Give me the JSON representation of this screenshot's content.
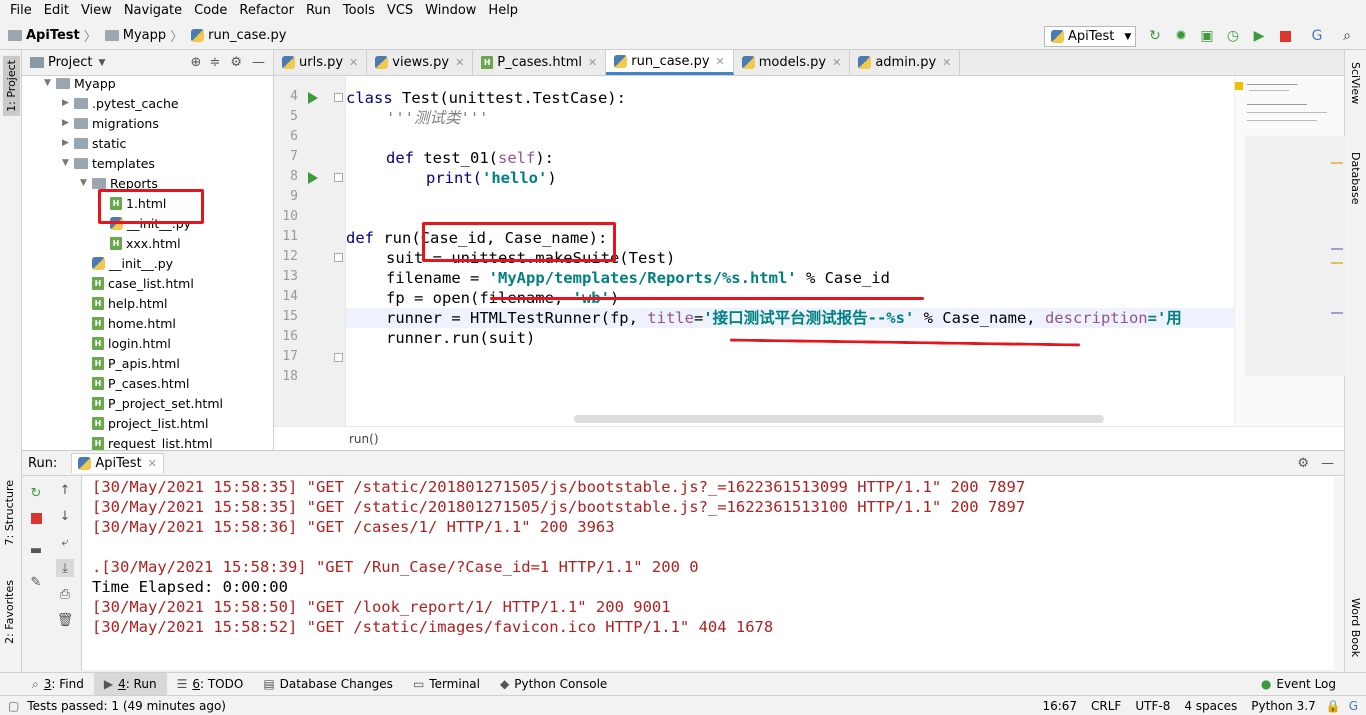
{
  "menu": [
    "File",
    "Edit",
    "View",
    "Navigate",
    "Code",
    "Refactor",
    "Run",
    "Tools",
    "VCS",
    "Window",
    "Help"
  ],
  "nav": {
    "project": "ApiTest",
    "folder": "Myapp",
    "file": "run_case.py"
  },
  "run_config": "ApiTest",
  "side_tabs": {
    "project": "1: Project",
    "structure": "7: Structure",
    "favorites": "2: Favorites",
    "sciview": "SciView",
    "database": "Database",
    "wordbook": "Word Book"
  },
  "project_panel": {
    "title": "Project",
    "items": [
      {
        "label": "Myapp",
        "indent": 0,
        "type": "folder",
        "arrow": "▼"
      },
      {
        "label": ".pytest_cache",
        "indent": 1,
        "type": "folder",
        "arrow": "▶"
      },
      {
        "label": "migrations",
        "indent": 1,
        "type": "folder",
        "arrow": "▶"
      },
      {
        "label": "static",
        "indent": 1,
        "type": "folder",
        "arrow": "▶"
      },
      {
        "label": "templates",
        "indent": 1,
        "type": "folder",
        "arrow": "▼"
      },
      {
        "label": "Reports",
        "indent": 2,
        "type": "folder",
        "arrow": "▼"
      },
      {
        "label": "1.html",
        "indent": 3,
        "type": "html",
        "arrow": ""
      },
      {
        "label": "__init__.py",
        "indent": 3,
        "type": "py",
        "arrow": ""
      },
      {
        "label": "xxx.html",
        "indent": 3,
        "type": "html",
        "arrow": ""
      },
      {
        "label": "__init__.py",
        "indent": 2,
        "type": "py",
        "arrow": ""
      },
      {
        "label": "case_list.html",
        "indent": 2,
        "type": "html",
        "arrow": ""
      },
      {
        "label": "help.html",
        "indent": 2,
        "type": "html",
        "arrow": ""
      },
      {
        "label": "home.html",
        "indent": 2,
        "type": "html",
        "arrow": ""
      },
      {
        "label": "login.html",
        "indent": 2,
        "type": "html",
        "arrow": ""
      },
      {
        "label": "P_apis.html",
        "indent": 2,
        "type": "html",
        "arrow": ""
      },
      {
        "label": "P_cases.html",
        "indent": 2,
        "type": "html",
        "arrow": ""
      },
      {
        "label": "P_project_set.html",
        "indent": 2,
        "type": "html",
        "arrow": ""
      },
      {
        "label": "project_list.html",
        "indent": 2,
        "type": "html",
        "arrow": ""
      },
      {
        "label": "request_list.html",
        "indent": 2,
        "type": "html",
        "arrow": ""
      }
    ]
  },
  "tabs": [
    {
      "label": "urls.py",
      "active": false
    },
    {
      "label": "views.py",
      "active": false
    },
    {
      "label": "P_cases.html",
      "active": false
    },
    {
      "label": "run_case.py",
      "active": true
    },
    {
      "label": "models.py",
      "active": false
    },
    {
      "label": "admin.py",
      "active": false
    }
  ],
  "line_numbers": [
    "4",
    "5",
    "6",
    "7",
    "8",
    "9",
    "10",
    "11",
    "12",
    "13",
    "14",
    "15",
    "16",
    "17",
    "18"
  ],
  "code": {
    "l4_kw": "class ",
    "l4_rest": "Test(unittest.TestCase):",
    "l5_doc": "'''测试类'''",
    "l8_kw": "def ",
    "l8_fn": "test_01(",
    "l8_self": "self",
    "l8_end": "):",
    "l9_print": "print(",
    "l9_str": "'hello'",
    "l9_end": ")",
    "l12_kw": "def ",
    "l12_rest": "run(Case_id, Case_name):",
    "l13": "suit = unittest.makeSuite(Test)",
    "l14_a": "filename = ",
    "l14_str": "'MyApp/templates/Reports/%s.html'",
    "l14_b": " % Case_id",
    "l15_a": "fp = open(filename, ",
    "l15_str": "'wb'",
    "l15_b": ")",
    "l16_a": "runner = HTMLTestRunner(fp, ",
    "l16_title": "title",
    "l16_eq": "=",
    "l16_str": "'接口测试平台测试报告--%s'",
    "l16_b": " % Case_name, ",
    "l16_desc": "description",
    "l16_c": "='用",
    "l17": "runner.run(suit)"
  },
  "editor_breadcrumb": "run()",
  "run_panel": {
    "label": "Run:",
    "tab": "ApiTest",
    "lines": [
      {
        "text": "[30/May/2021 15:58:35] \"GET /static/201801271505/js/bootstable.js?_=1622361513099 HTTP/1.1\" 200 7897",
        "kind": "err"
      },
      {
        "text": "[30/May/2021 15:58:35] \"GET /static/201801271505/js/bootstable.js?_=1622361513100 HTTP/1.1\" 200 7897",
        "kind": "err"
      },
      {
        "text": "[30/May/2021 15:58:36] \"GET /cases/1/ HTTP/1.1\" 200 3963",
        "kind": "err"
      },
      {
        "text": "",
        "kind": "out"
      },
      {
        "text": ".[30/May/2021 15:58:39] \"GET /Run_Case/?Case_id=1 HTTP/1.1\" 200 0",
        "kind": "err"
      },
      {
        "text": "Time Elapsed: 0:00:00",
        "kind": "out"
      },
      {
        "text": "[30/May/2021 15:58:50] \"GET /look_report/1/ HTTP/1.1\" 200 9001",
        "kind": "err"
      },
      {
        "text": "[30/May/2021 15:58:52] \"GET /static/images/favicon.ico HTTP/1.1\" 404 1678",
        "kind": "err"
      }
    ]
  },
  "bottom_tabs": [
    {
      "key": "3",
      "label": ": Find",
      "active": false
    },
    {
      "key": "4",
      "label": ": Run",
      "active": true
    },
    {
      "key": "6",
      "label": ": TODO",
      "active": false
    },
    {
      "key": "",
      "label": "Database Changes",
      "active": false
    },
    {
      "key": "",
      "label": "Terminal",
      "active": false
    },
    {
      "key": "",
      "label": "Python Console",
      "active": false
    }
  ],
  "event_log": "Event Log",
  "status": {
    "message": "Tests passed: 1 (49 minutes ago)",
    "position": "16:67",
    "line_sep": "CRLF",
    "encoding": "UTF-8",
    "indent": "4 spaces",
    "interpreter": "Python 3.7"
  },
  "colors": {
    "annotation_red": "#e8141c",
    "accent": "#4083c9",
    "console_red": "#b02020"
  }
}
